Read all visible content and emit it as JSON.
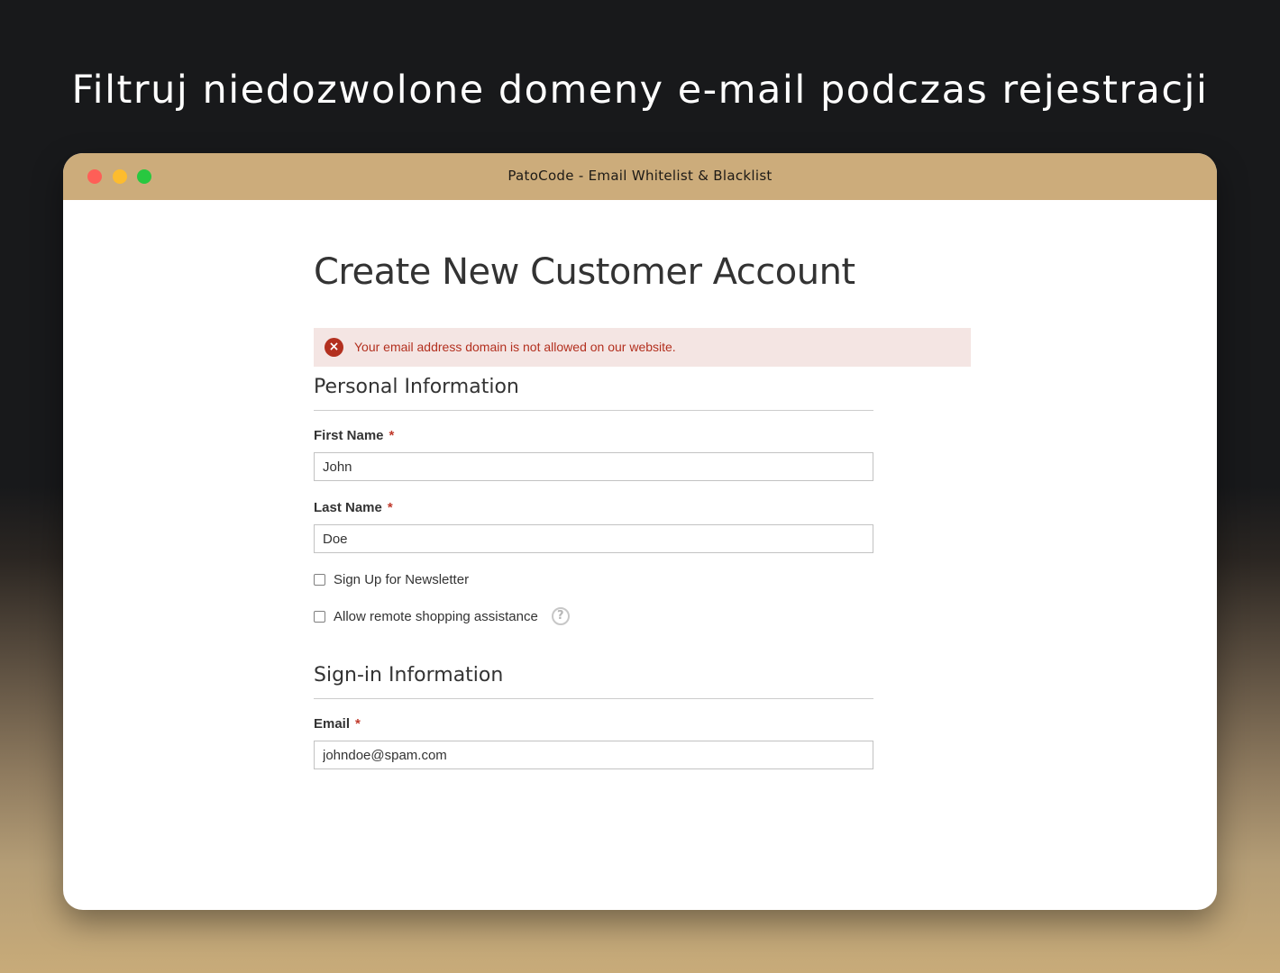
{
  "headline": "Filtruj niedozwolone domeny e-mail podczas rejestracji",
  "window": {
    "title": "PatoCode - Email Whitelist & Blacklist"
  },
  "page": {
    "title": "Create New Customer Account",
    "error_message": "Your email address domain is not allowed on our website."
  },
  "personal_info": {
    "heading": "Personal Information",
    "first_name": {
      "label": "First Name",
      "required_mark": "*",
      "value": "John"
    },
    "last_name": {
      "label": "Last Name",
      "required_mark": "*",
      "value": "Doe"
    },
    "newsletter": {
      "label": "Sign Up for Newsletter",
      "checked": false
    },
    "remote_assistance": {
      "label": "Allow remote shopping assistance",
      "checked": false,
      "help_icon": "?"
    }
  },
  "signin_info": {
    "heading": "Sign-in Information",
    "email": {
      "label": "Email",
      "required_mark": "*",
      "value": "johndoe@spam.com"
    }
  },
  "icons": {
    "error": "×",
    "window_controls": [
      "close",
      "minimize",
      "maximize"
    ]
  },
  "colors": {
    "titlebar": "#ccac7b",
    "error_background": "#f4e5e3",
    "error_text": "#b3301f",
    "close_dot": "#fe5f57",
    "minimize_dot": "#fdbc2e",
    "maximize_dot": "#28c840"
  }
}
